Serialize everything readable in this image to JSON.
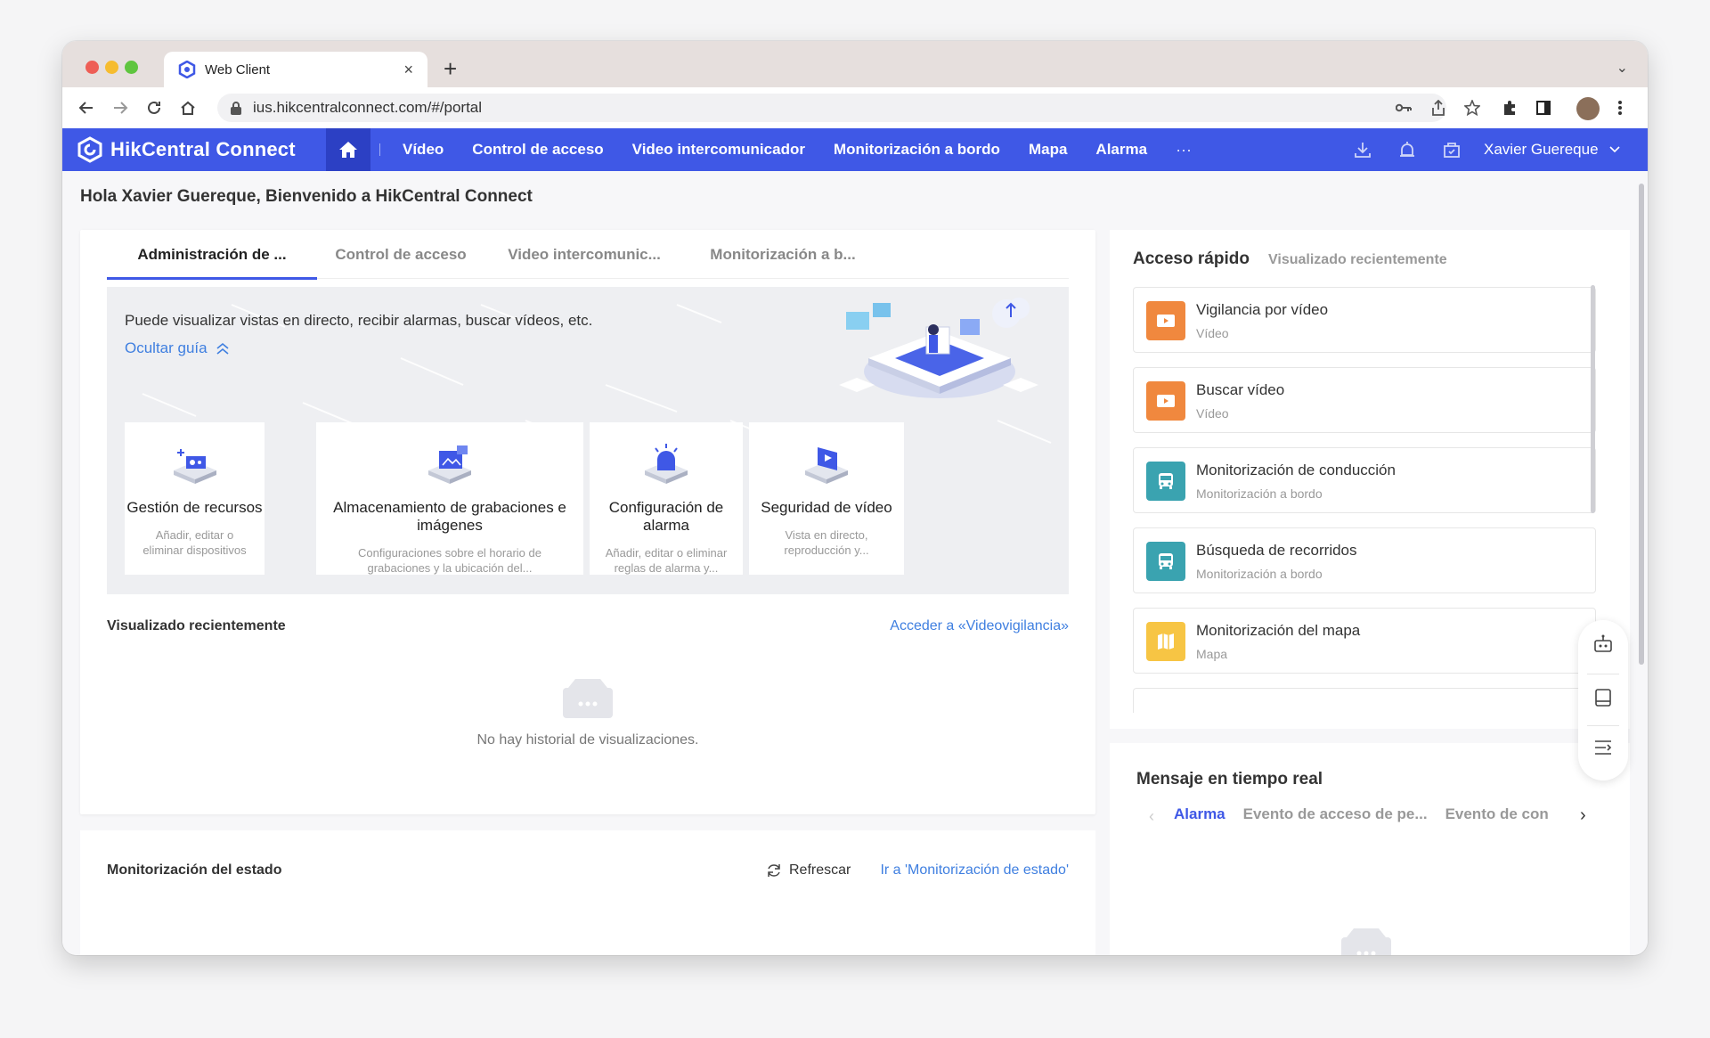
{
  "browser": {
    "tab_title": "Web Client",
    "new_tab": "+",
    "close": "×",
    "tab_menu": "⌄",
    "url": "ius.hikcentralconnect.com/#/portal"
  },
  "app": {
    "brand": "HikCentral Connect",
    "nav": [
      "Vídeo",
      "Control de acceso",
      "Video intercomunicador",
      "Monitorización a bordo",
      "Mapa",
      "Alarma"
    ],
    "nav_more": "···",
    "user": "Xavier Guereque",
    "accent": "#3f58e6",
    "link_color": "#3f7fe0"
  },
  "welcome": "Hola Xavier Guereque, Bienvenido a HikCentral Connect",
  "portal": {
    "tabs": [
      "Administración de ...",
      "Control de acceso",
      "Video intercomunic...",
      "Monitorización a b..."
    ],
    "guide_text": "Puede visualizar vistas en directo, recibir alarmas, buscar vídeos, etc.",
    "guide_link": "Ocultar guía",
    "features": [
      {
        "title": "Gestión de recursos",
        "desc": "Añadir, editar o eliminar dispositivos ..."
      },
      {
        "title": "Almacenamiento de grabaciones e imágenes",
        "desc": "Configuraciones sobre el horario de grabaciones y la ubicación del..."
      },
      {
        "title": "Configuración de alarma",
        "desc": "Añadir, editar o eliminar reglas de alarma y..."
      },
      {
        "title": "Seguridad de vídeo",
        "desc": "Vista en directo, reproducción y..."
      }
    ]
  },
  "recent": {
    "title": "Visualizado recientemente",
    "link": "Acceder a «Videovigilancia»",
    "empty": "No hay historial de visualizaciones."
  },
  "status": {
    "title": "Monitorización del estado",
    "refresh": "Refrescar",
    "link": "Ir a 'Monitorización de estado'"
  },
  "quick_access": {
    "title": "Acceso rápido",
    "subtitle": "Visualizado recientemente",
    "items": [
      {
        "name": "Vigilancia por vídeo",
        "category": "Vídeo",
        "color": "#f0883e",
        "icon": "video-icon"
      },
      {
        "name": "Buscar vídeo",
        "category": "Vídeo",
        "color": "#f0883e",
        "icon": "video-icon"
      },
      {
        "name": "Monitorización de conducción",
        "category": "Monitorización a bordo",
        "color": "#3aa3b0",
        "icon": "bus-icon"
      },
      {
        "name": "Búsqueda de recorridos",
        "category": "Monitorización a bordo",
        "color": "#3aa3b0",
        "icon": "bus-icon"
      },
      {
        "name": "Monitorización del mapa",
        "category": "Mapa",
        "color": "#f7c544",
        "icon": "map-icon"
      }
    ]
  },
  "messages": {
    "title": "Mensaje en tiempo real",
    "tabs": [
      "Alarma",
      "Evento de acceso de pe...",
      "Evento de con"
    ]
  }
}
